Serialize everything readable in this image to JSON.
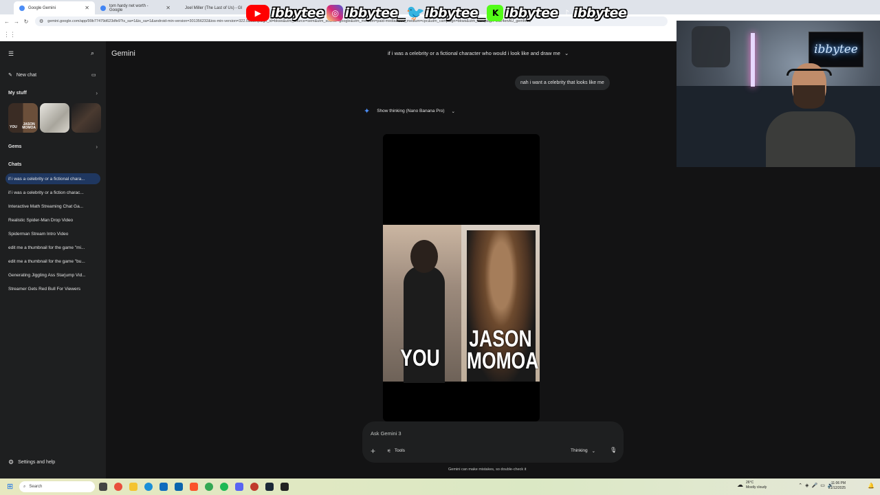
{
  "browser": {
    "tabs": [
      {
        "label": "Google Gemini",
        "active": true
      },
      {
        "label": "tom hardy net worth - Google",
        "active": false
      },
      {
        "label": "Joel Miller (The Last of Us) - Gl",
        "active": false
      }
    ],
    "url": "gemini.google.com/app/99b77479d623dfe9?is_sa=1&is_sa=1&android-min-version=301356232&ios-min-version=322.0&campaign_id=bkws&utm_source=sem&utm_source=google&utm_medium=paid-media&utm_medium=cpc&utm_campaign=bkws&utm_campaign=2024enAU_gemfeb&"
  },
  "overlay": {
    "handles": [
      {
        "platform": "youtube-icon",
        "handle": "ibbytee",
        "color": "#ff0000"
      },
      {
        "platform": "instagram-icon",
        "handle": "ibbytee_",
        "color": "#d6249f"
      },
      {
        "platform": "twitter-icon",
        "handle": "ibbytee_",
        "color": "#1da1f2"
      },
      {
        "platform": "kick-icon",
        "handle": "ibbytee",
        "color": "#53fc18"
      },
      {
        "platform": "tiktok-icon",
        "handle": "ibbytee",
        "color": "#000000"
      }
    ],
    "webcam_sign": "ibbytee"
  },
  "sidebar": {
    "new_chat": "New chat",
    "my_stuff": "My stuff",
    "gems": "Gems",
    "chats_heading": "Chats",
    "chats": [
      "if i was a celebrity or a fictional chara...",
      "if i was a celebrity or a fiction charac...",
      "Interactive Math Streaming Chat Ga...",
      "Realistic Spider-Man Drop Video",
      "Spiderman Stream Intro Video",
      "edit me a thumbnail for the game \"mi...",
      "edit me a thumbnail for the game \"bu...",
      "Generating Jiggling Ass Starjump Vid...",
      "Streamer Gets Red Bull For Viewers"
    ],
    "settings": "Settings and help"
  },
  "main": {
    "brand": "Gemini",
    "topic": "if i was a celebrity or a fictional character who would i look like and draw me",
    "user_message": "nah i want a celebrity that looks like me",
    "thinking_label": "Show thinking (Nano Banana Pro)",
    "image_labels": {
      "left": "YOU",
      "right_line1": "JASON",
      "right_line2": "MOMOA"
    },
    "composer": {
      "placeholder": "Ask Gemini 3",
      "tools": "Tools",
      "mode": "Thinking"
    },
    "disclaimer": "Gemini can make mistakes, so double-check it"
  },
  "taskbar": {
    "search": "Search",
    "weather_temp": "26°C",
    "weather_desc": "Mostly cloudy",
    "time": "11:06 PM",
    "date": "21/12/2025"
  }
}
